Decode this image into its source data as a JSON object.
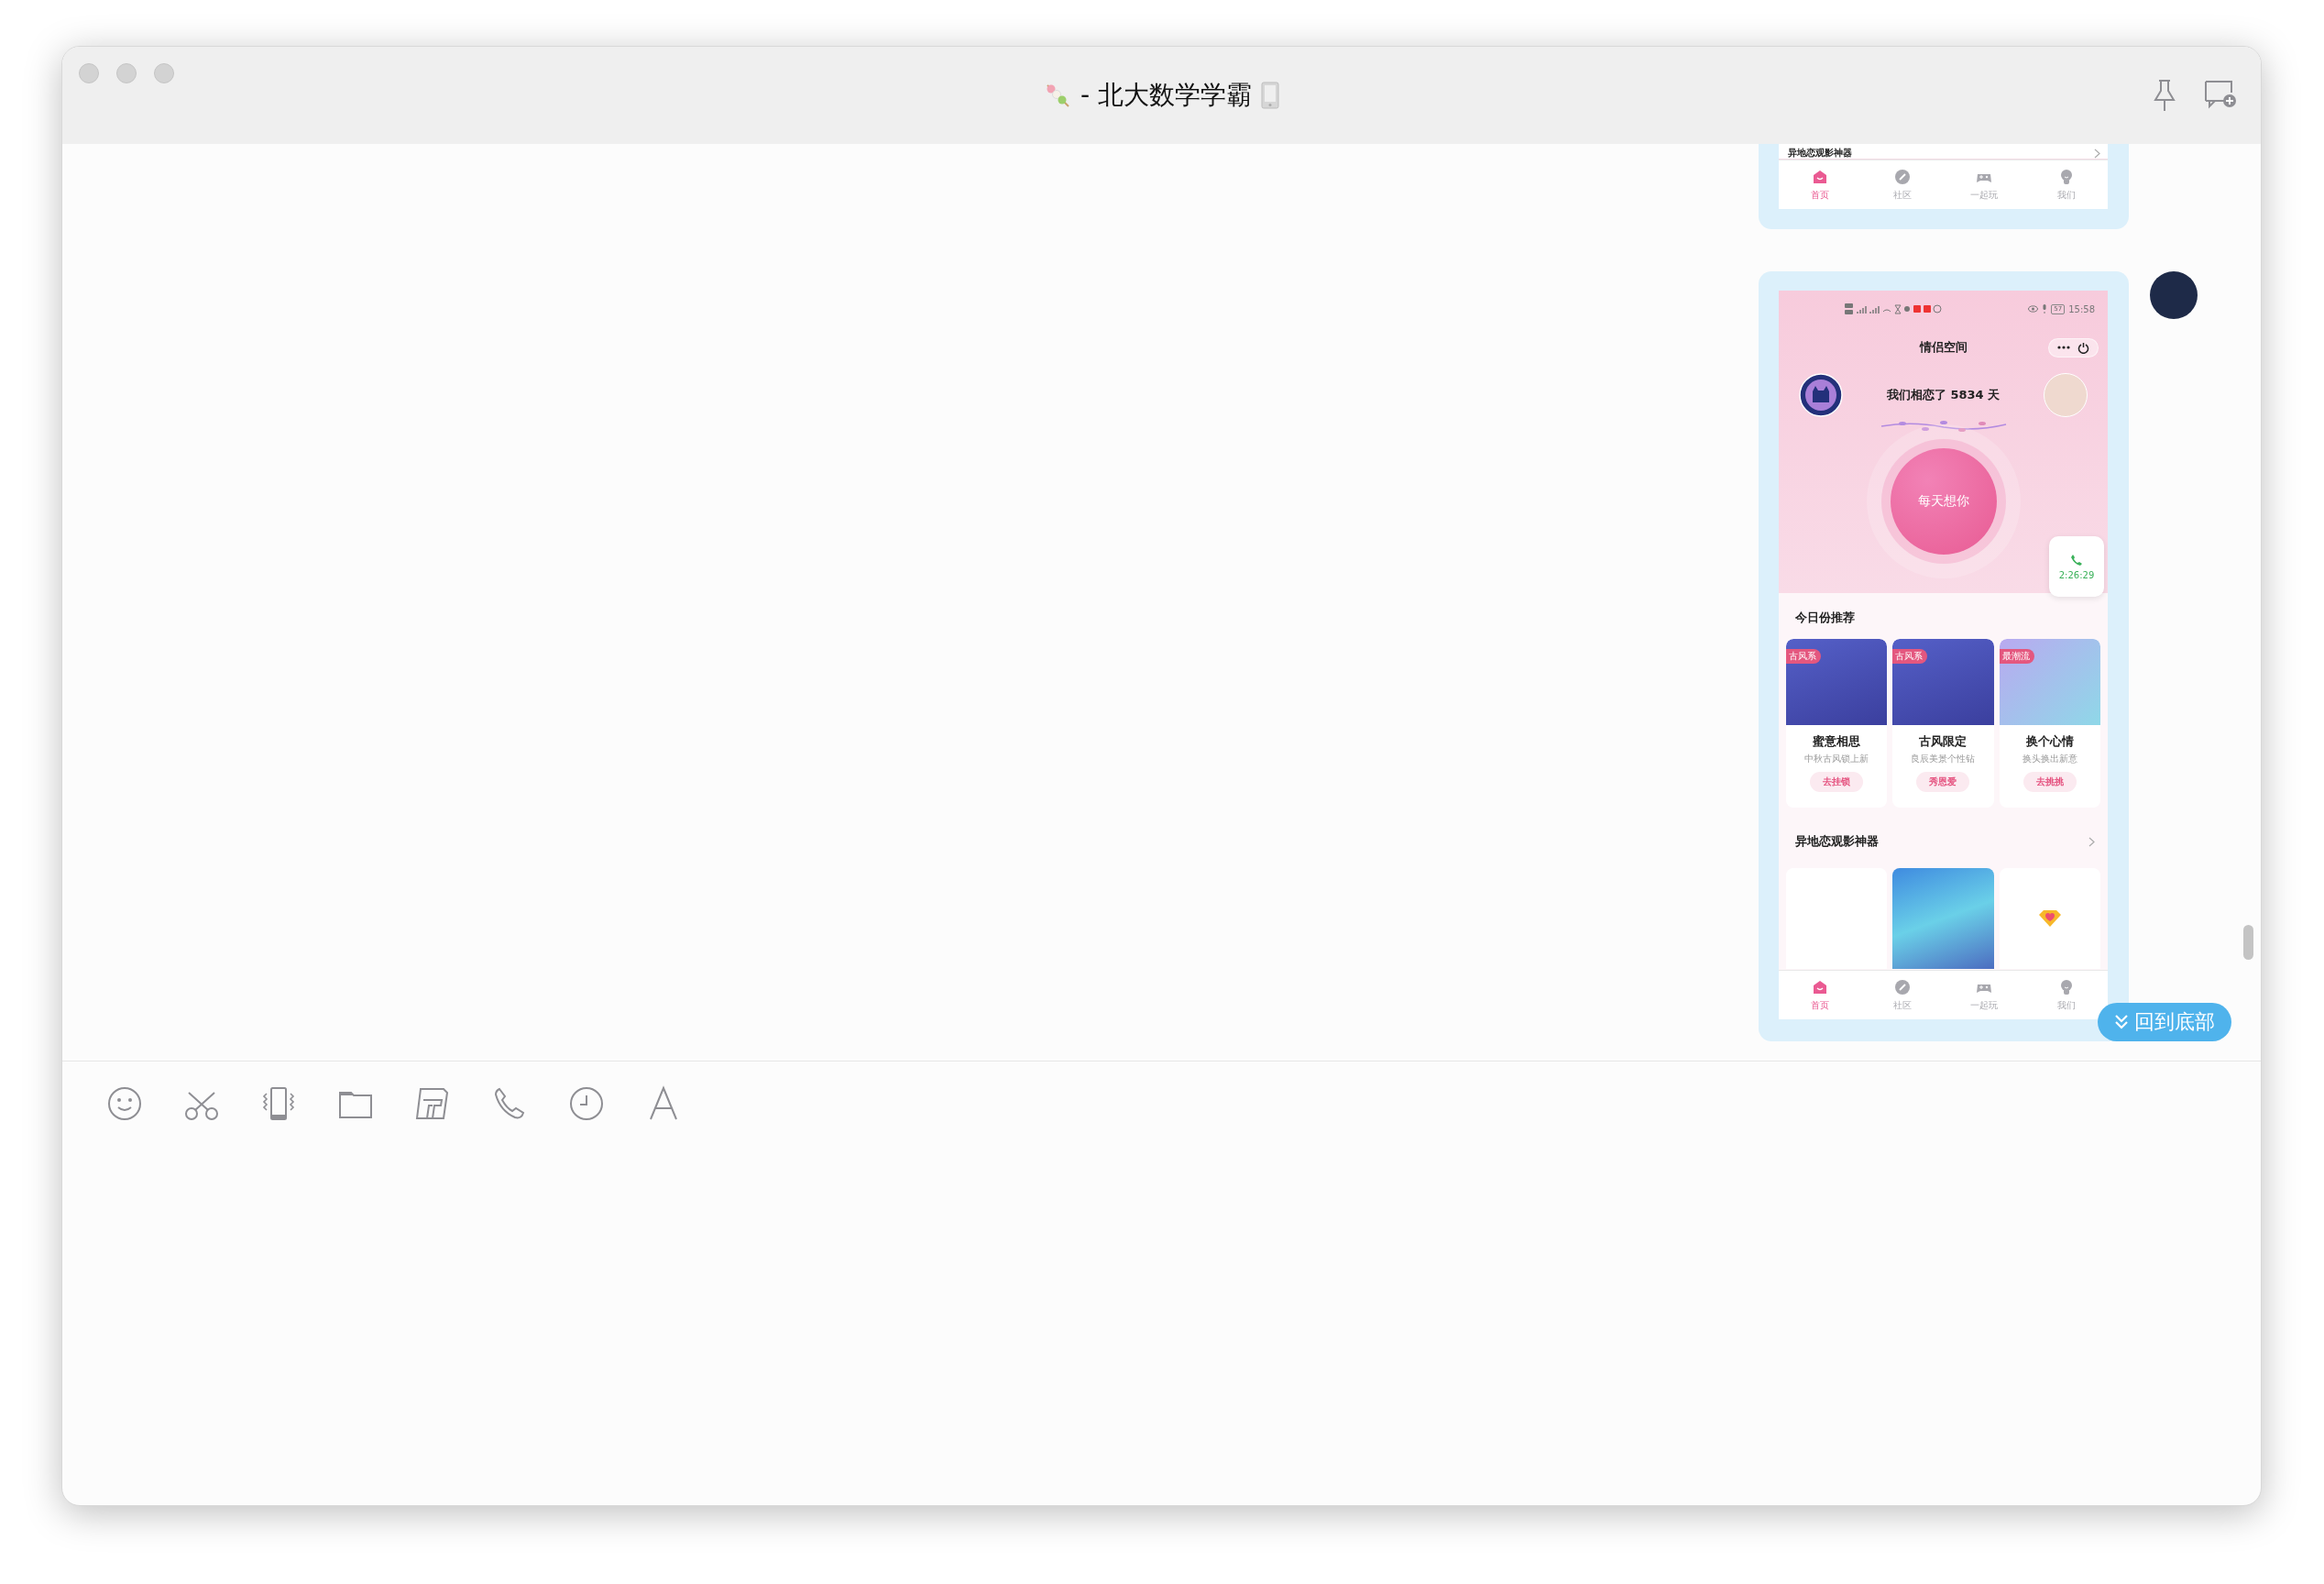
{
  "window": {
    "title": "- 北大数学学霸"
  },
  "messages": [
    {
      "kind": "partial",
      "screenshot": {
        "section_title": "异地恋观影神器",
        "nav": [
          {
            "label": "首页",
            "selected": true
          },
          {
            "label": "社区",
            "selected": false
          },
          {
            "label": "一起玩",
            "selected": false
          },
          {
            "label": "我们",
            "selected": false
          }
        ]
      }
    },
    {
      "kind": "full",
      "screenshot": {
        "status_bar": {
          "battery": "57",
          "time": "15:58"
        },
        "title": "情侣空间",
        "love_counter": "我们相恋了 5834 天",
        "main_button": "每天想你",
        "call_timer": "2:26:29",
        "recommend_title": "今日份推荐",
        "recommend_cards": [
          {
            "tag": "古风系",
            "title": "蜜意相思",
            "subtitle": "中秋古风锁上新",
            "action": "去挂锁"
          },
          {
            "tag": "古风系",
            "title": "古风限定",
            "subtitle": "良辰美景个性钻",
            "action": "秀恩爱"
          },
          {
            "tag": "最潮流",
            "title": "换个心情",
            "subtitle": "换头换出新意",
            "action": "去挑挑"
          }
        ],
        "section_title": "异地恋观影神器",
        "media_cards": [
          {
            "kind": "blank"
          },
          {
            "kind": "poster"
          },
          {
            "kind": "gem"
          }
        ],
        "nav": [
          {
            "label": "首页",
            "selected": true
          },
          {
            "label": "社区",
            "selected": false
          },
          {
            "label": "一起玩",
            "selected": false
          },
          {
            "label": "我们",
            "selected": false
          }
        ]
      }
    }
  ],
  "scroll_button": {
    "label": "回到底部"
  }
}
